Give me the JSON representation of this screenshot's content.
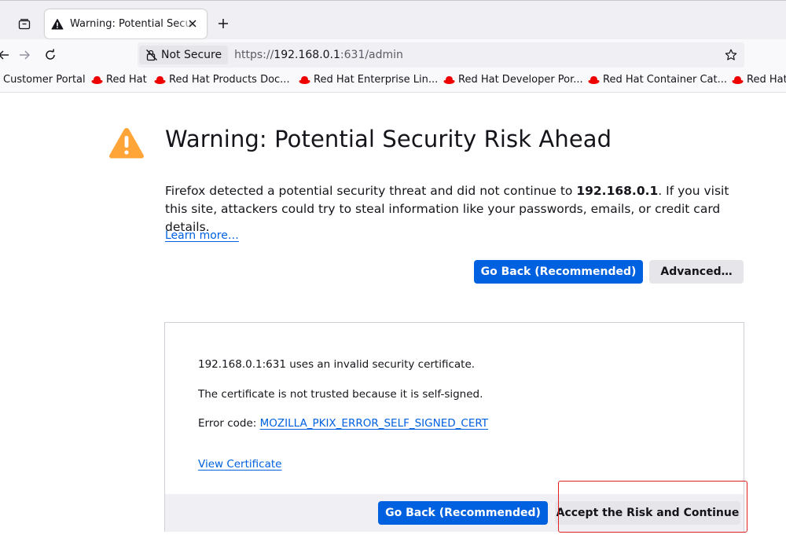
{
  "browser": {
    "tab": {
      "title": "Warning: Potential Security Risk Ahead"
    },
    "urlbar": {
      "identity_label": "Not Secure",
      "url_scheme": "https://",
      "url_host": "192.168.0.1",
      "url_path": ":631/admin"
    },
    "bookmarks": [
      {
        "label": "Customer Portal"
      },
      {
        "label": "Red Hat"
      },
      {
        "label": "Red Hat Products Doc..."
      },
      {
        "label": "Red Hat Enterprise Lin..."
      },
      {
        "label": "Red Hat Developer Por..."
      },
      {
        "label": "Red Hat Container Cat..."
      },
      {
        "label": "Red Hat"
      }
    ]
  },
  "page": {
    "title": "Warning: Potential Security Risk Ahead",
    "intro_before": "Firefox detected a potential security threat and did not continue to ",
    "intro_host": "192.168.0.1",
    "intro_after": ". If you visit this site, attackers could try to steal information like your passwords, emails, or credit card details.",
    "learn_more": "Learn more…",
    "go_back_label": "Go Back (Recommended)",
    "advanced_label": "Advanced…"
  },
  "advanced": {
    "line1": "192.168.0.1:631 uses an invalid security certificate.",
    "line2": "The certificate is not trusted because it is self-signed.",
    "error_code_prefix": "Error code: ",
    "error_code": "MOZILLA_PKIX_ERROR_SELF_SIGNED_CERT",
    "view_certificate": "View Certificate",
    "go_back_label": "Go Back (Recommended)",
    "accept_label": "Accept the Risk and Continue"
  },
  "colors": {
    "accent": "#0061e0",
    "warning": "#ffa436",
    "highlight": "#e02020",
    "redhat": "#ee0000"
  }
}
